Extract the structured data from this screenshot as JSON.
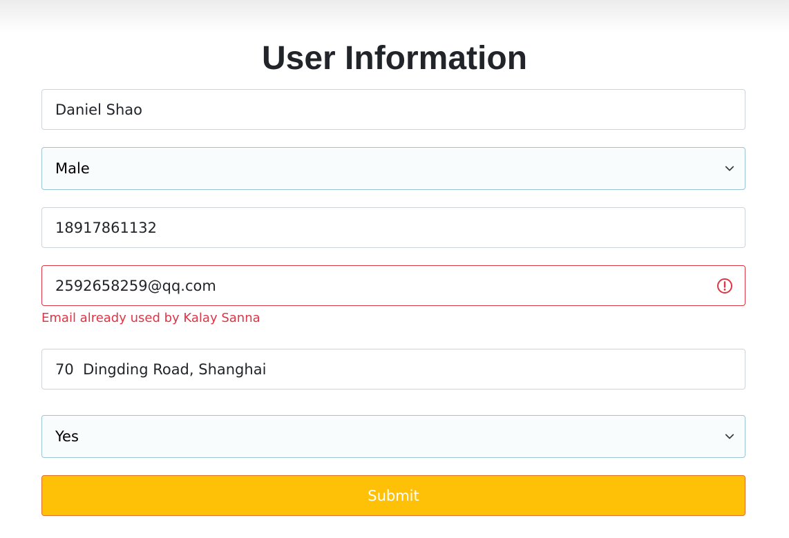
{
  "page": {
    "title": "User Information"
  },
  "form": {
    "name": {
      "value": "Daniel Shao"
    },
    "gender": {
      "selected": "Male"
    },
    "phone": {
      "value": "18917861132"
    },
    "email": {
      "value": "2592658259@qq.com",
      "error": "Email already used by Kalay Sanna"
    },
    "address": {
      "value": "70  Dingding Road, Shanghai"
    },
    "choice": {
      "selected": "Yes"
    },
    "submit_label": "Submit"
  },
  "colors": {
    "error": "#dc3545",
    "submit_bg": "#ffc107",
    "select_bg": "#f8fcfd",
    "select_border": "#9cc5d4"
  },
  "icons": {
    "select_arrow": "chevron-down-icon",
    "error": "error-circle-icon"
  }
}
